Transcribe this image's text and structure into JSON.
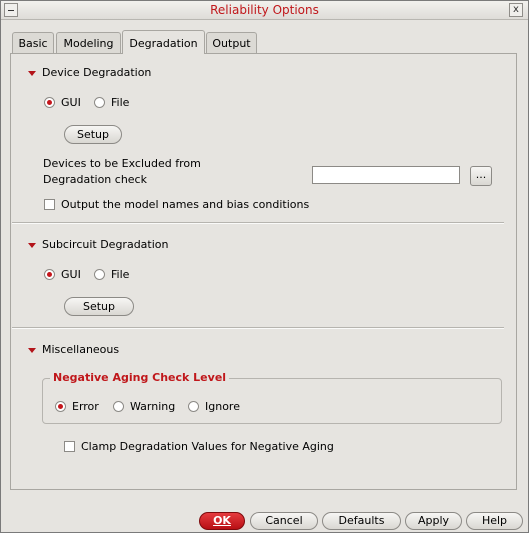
{
  "window": {
    "title": "Reliability Options",
    "close_glyph": "x"
  },
  "tabs": [
    {
      "label": "Basic"
    },
    {
      "label": "Modeling"
    },
    {
      "label": "Degradation"
    },
    {
      "label": "Output"
    }
  ],
  "active_tab": "Degradation",
  "device_degradation": {
    "header": "Device Degradation",
    "radio_gui": "GUI",
    "radio_file": "File",
    "selected": "GUI",
    "setup_label": "Setup",
    "exclude_label_line1": "Devices to be Excluded from",
    "exclude_label_line2": "Degradation check",
    "exclude_value": "",
    "browse_label": "...",
    "output_model_label": "Output the model names and bias conditions",
    "output_model_checked": false
  },
  "subcircuit_degradation": {
    "header": "Subcircuit Degradation",
    "radio_gui": "GUI",
    "radio_file": "File",
    "selected": "GUI",
    "setup_label": "Setup"
  },
  "miscellaneous": {
    "header": "Miscellaneous",
    "group_title": "Negative Aging Check Level",
    "options": [
      "Error",
      "Warning",
      "Ignore"
    ],
    "selected": "Error",
    "clamp_label": "Clamp Degradation Values for Negative Aging",
    "clamp_checked": false
  },
  "footer": {
    "ok": "OK",
    "cancel": "Cancel",
    "defaults": "Defaults",
    "apply": "Apply",
    "help": "Help"
  },
  "colors": {
    "accent_red": "#c0171b",
    "window_bg": "#e6e4e0"
  }
}
